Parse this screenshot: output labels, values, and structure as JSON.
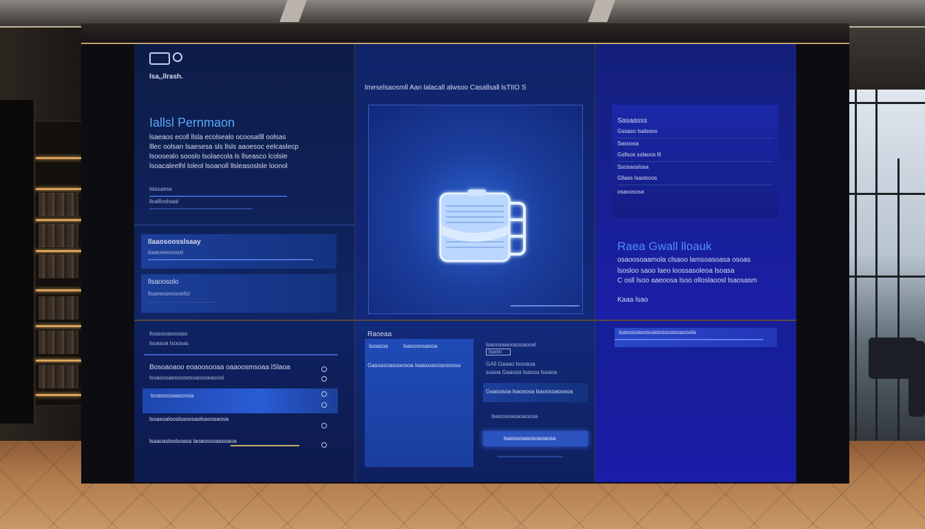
{
  "panel_left": {
    "brand": "lsa,,llrash.",
    "headline": "Iallsl Pernmaon",
    "body": [
      "lsaeaos ecoll llsla ecolsealo ocoosallll oolsas",
      "lllec oolsan lsaesesa sls llsls aaoesoc eelcaslecp",
      "lsoosealo sooslo lsolaecola ls llseasco lcolsle",
      "lsoacaleelhl loleol lsoanoll llsleasoslsle loonol"
    ],
    "field1_label": "lslasaess",
    "field2_label": "llsallloslsaal",
    "row1_title": "llaaosoosslsaay",
    "row1_sub": "lsaaoseeooosl",
    "row2_title": "llsaoosolo",
    "row2_sub": "llsaeeoseoooellsl"
  },
  "panel_center": {
    "title": "lmeselsaosmll Aan lalacall alwsoo Casallsall lsTIIO S",
    "icon": "folder-icon"
  },
  "panel_right": {
    "menu_title": "Sasaasss",
    "menu_items": [
      "Gssaso lsalsoos",
      "Sasoosa",
      "Gsllsos sslaoos lll",
      "Ssosaoslosa",
      "Gllaes lsaslsoos",
      "osaoososa"
    ],
    "headline": "Raea Gwall lloauk",
    "body": [
      "osaoosoaamola clsaoo lamsoasoasa osoas",
      "lsosloo saoo laeo loossasoleoa lsoasa",
      "C osll lsoo aaeoosa lsoo olloslaoosl lsaosasm",
      "Kaaa lsao"
    ]
  },
  "panel_bottom_left": {
    "header": "lloasooasooaso",
    "sub": "lsoasoa lsoosas",
    "items": [
      {
        "text": "Bosoaoaoo eoaoosooaa oaaoosmsoaa lSlaoa",
        "sub": "lsoaoosaesoooesoaoooeaoosl"
      },
      {
        "text": "lsoasoooaasoosa",
        "sub": ""
      },
      {
        "text": "lsoasoalooslsaoosaolsaoosaooa",
        "sub": ""
      },
      {
        "text": "lsaaoasloolsoasa laoaosooaasoaoa",
        "sub": ""
      }
    ]
  },
  "panel_bottom_center": {
    "header": "Raoeaa",
    "tabs": [
      "lsoasoa",
      "lsaoososaooa"
    ],
    "list_title": "Gasoasoasoaosoa lsaasoasoaosoosa",
    "right_rows": [
      "lsaoosaaoososaoosl",
      "lsaoo",
      "GAll Gaaao lsooaoa",
      "ssaoa Gaaosa lsaooa lsoaoa",
      "Gsaoosoa lsaososa lsaoosoaoosoa",
      "lsaoosoaoaoaoosa"
    ],
    "button_label": "lsaoosoaaosoaoaosa"
  },
  "panel_bottom_right": {
    "bar_text": "lsaoosoaoosoaoosooasoaoosla"
  },
  "colors": {
    "accent_blue": "#5aa8ff",
    "panel_dark": "#0d1c47",
    "panel_royal": "#1b1ca8"
  }
}
